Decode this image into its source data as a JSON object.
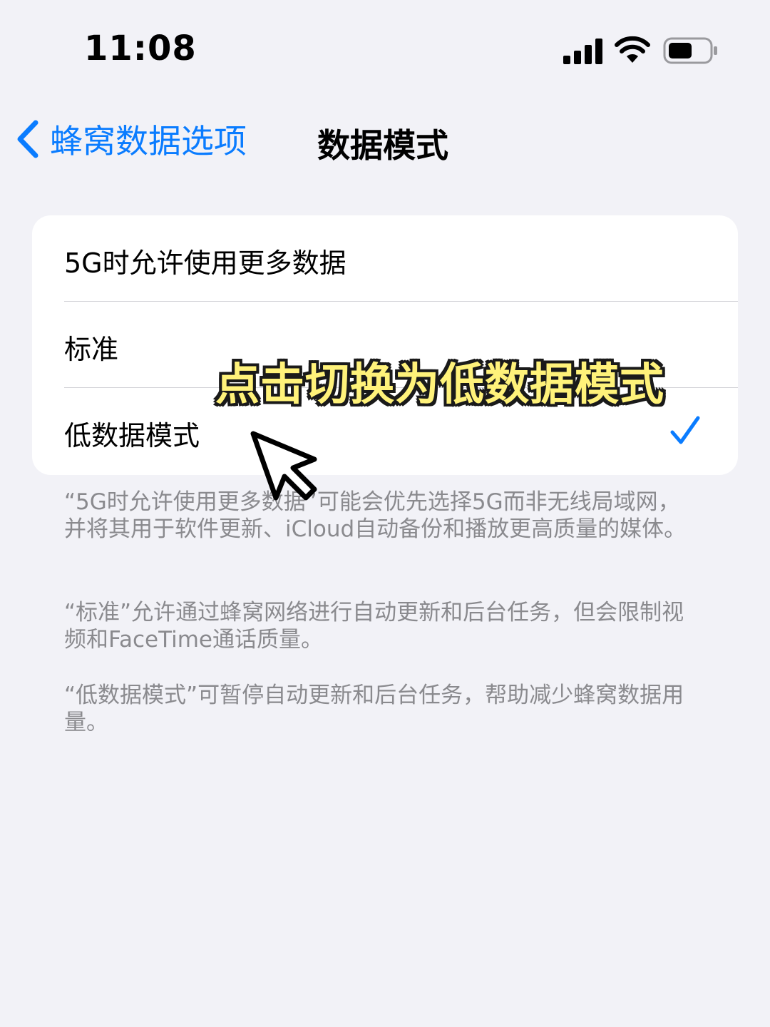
{
  "status_bar": {
    "time": "11:08",
    "icons": [
      "signal-icon",
      "wifi-icon",
      "battery-icon"
    ]
  },
  "nav": {
    "back_label": "蜂窝数据选项",
    "title": "数据模式"
  },
  "options": [
    {
      "label": "5G时允许使用更多数据",
      "selected": false
    },
    {
      "label": "标准",
      "selected": false
    },
    {
      "label": "低数据模式",
      "selected": true
    }
  ],
  "annotation": {
    "text": "点击切换为低数据模式"
  },
  "footnotes": [
    "“5G时允许使用更多数据”可能会优先选择5G而非无线局域网，并将其用于软件更新、iCloud自动备份和播放更高质量的媒体。",
    "“标准”允许通过蜂窝网络进行自动更新和后台任务，但会限制视频和FaceTime通话质量。",
    "“低数据模式”可暂停自动更新和后台任务，帮助减少蜂窝数据用量。"
  ],
  "colors": {
    "accent": "#0a7cff",
    "background": "#f2f2f7",
    "footnote": "#8a8a8e",
    "annotation_fill": "#fff27a"
  }
}
